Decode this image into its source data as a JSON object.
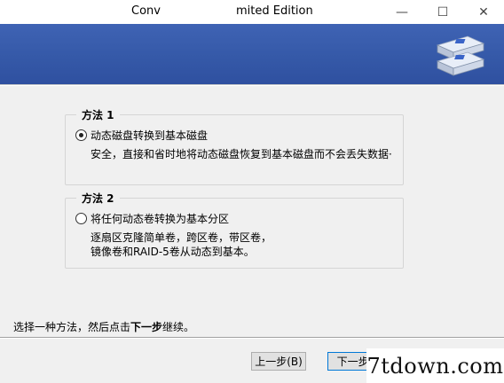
{
  "window": {
    "title_part1": "Conv",
    "title_part2": "mited Edition",
    "minimize_glyph": "—",
    "maximize_glyph": "☐",
    "close_glyph": "✕"
  },
  "banner": {
    "accent_color": "#3a5fb0",
    "icon": "disk-drives-icon"
  },
  "method1": {
    "legend": "方法 1",
    "option_label": "动态磁盘转换到基本磁盘",
    "description": "安全，直接和省时地将动态磁盘恢复到基本磁盘而不会丢失数据·",
    "selected": true
  },
  "method2": {
    "legend": "方法 2",
    "option_label": "将任何动态卷转换为基本分区",
    "description": "逐扇区克隆简单卷，跨区卷，带区卷，镜像卷和RAID-5卷从动态到基本。",
    "selected": false
  },
  "instruction": {
    "prefix": "选择一种方法，然后点击",
    "bold": "下一步",
    "suffix": "继续。"
  },
  "buttons": {
    "back": "上一步(B)",
    "next": "下一步("
  },
  "watermark": {
    "text": "7tdown.com"
  }
}
